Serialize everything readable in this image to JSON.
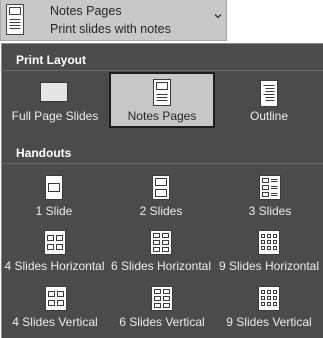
{
  "selector": {
    "title": "Notes Pages",
    "subtitle": "Print slides with notes",
    "icon": "notes-page-icon",
    "dropdown_icon": "chevron-down-icon"
  },
  "print_layout": {
    "heading": "Print Layout",
    "items": [
      {
        "label": "Full Page Slides",
        "icon": "full-page-slide-icon",
        "selected": false
      },
      {
        "label": "Notes Pages",
        "icon": "notes-page-icon",
        "selected": true
      },
      {
        "label": "Outline",
        "icon": "outline-icon",
        "selected": false
      }
    ]
  },
  "handouts": {
    "heading": "Handouts",
    "items": [
      {
        "label": "1 Slide",
        "icon": "handout-1-slide-icon"
      },
      {
        "label": "2 Slides",
        "icon": "handout-2-slides-icon"
      },
      {
        "label": "3 Slides",
        "icon": "handout-3-slides-icon"
      },
      {
        "label": "4 Slides Horizontal",
        "icon": "handout-4-horizontal-icon"
      },
      {
        "label": "6 Slides Horizontal",
        "icon": "handout-6-horizontal-icon"
      },
      {
        "label": "9 Slides Horizontal",
        "icon": "handout-9-horizontal-icon"
      },
      {
        "label": "4 Slides Vertical",
        "icon": "handout-4-vertical-icon"
      },
      {
        "label": "6 Slides Vertical",
        "icon": "handout-6-vertical-icon"
      },
      {
        "label": "9 Slides Vertical",
        "icon": "handout-9-vertical-icon"
      }
    ]
  },
  "colors": {
    "panel_background": "#4b4b4b",
    "selected_background": "#c7c7c7",
    "selected_border": "#1b1b1b",
    "selector_background": "#c8c8c8"
  }
}
